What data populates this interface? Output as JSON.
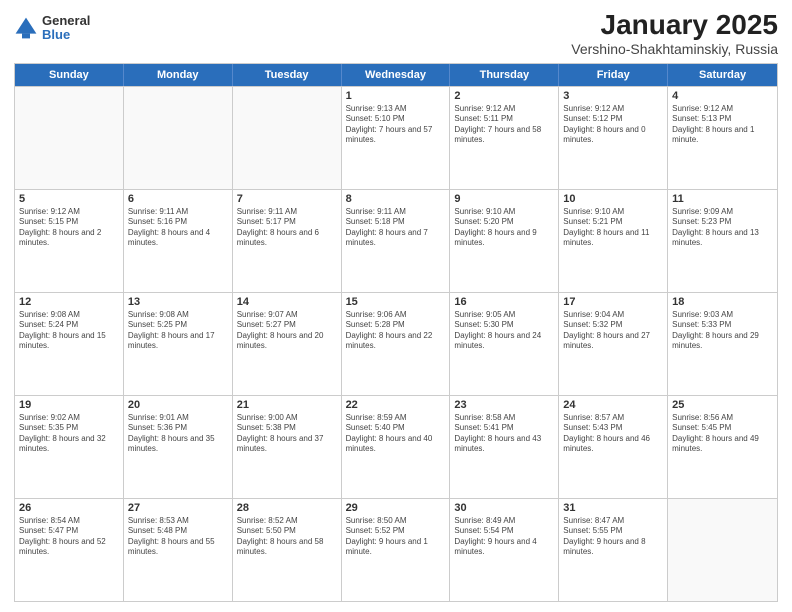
{
  "logo": {
    "general": "General",
    "blue": "Blue"
  },
  "title": "January 2025",
  "subtitle": "Vershino-Shakhtaminskiy, Russia",
  "days": [
    "Sunday",
    "Monday",
    "Tuesday",
    "Wednesday",
    "Thursday",
    "Friday",
    "Saturday"
  ],
  "weeks": [
    [
      {
        "day": "",
        "sunrise": "",
        "sunset": "",
        "daylight": ""
      },
      {
        "day": "",
        "sunrise": "",
        "sunset": "",
        "daylight": ""
      },
      {
        "day": "",
        "sunrise": "",
        "sunset": "",
        "daylight": ""
      },
      {
        "day": "1",
        "sunrise": "Sunrise: 9:13 AM",
        "sunset": "Sunset: 5:10 PM",
        "daylight": "Daylight: 7 hours and 57 minutes."
      },
      {
        "day": "2",
        "sunrise": "Sunrise: 9:12 AM",
        "sunset": "Sunset: 5:11 PM",
        "daylight": "Daylight: 7 hours and 58 minutes."
      },
      {
        "day": "3",
        "sunrise": "Sunrise: 9:12 AM",
        "sunset": "Sunset: 5:12 PM",
        "daylight": "Daylight: 8 hours and 0 minutes."
      },
      {
        "day": "4",
        "sunrise": "Sunrise: 9:12 AM",
        "sunset": "Sunset: 5:13 PM",
        "daylight": "Daylight: 8 hours and 1 minute."
      }
    ],
    [
      {
        "day": "5",
        "sunrise": "Sunrise: 9:12 AM",
        "sunset": "Sunset: 5:15 PM",
        "daylight": "Daylight: 8 hours and 2 minutes."
      },
      {
        "day": "6",
        "sunrise": "Sunrise: 9:11 AM",
        "sunset": "Sunset: 5:16 PM",
        "daylight": "Daylight: 8 hours and 4 minutes."
      },
      {
        "day": "7",
        "sunrise": "Sunrise: 9:11 AM",
        "sunset": "Sunset: 5:17 PM",
        "daylight": "Daylight: 8 hours and 6 minutes."
      },
      {
        "day": "8",
        "sunrise": "Sunrise: 9:11 AM",
        "sunset": "Sunset: 5:18 PM",
        "daylight": "Daylight: 8 hours and 7 minutes."
      },
      {
        "day": "9",
        "sunrise": "Sunrise: 9:10 AM",
        "sunset": "Sunset: 5:20 PM",
        "daylight": "Daylight: 8 hours and 9 minutes."
      },
      {
        "day": "10",
        "sunrise": "Sunrise: 9:10 AM",
        "sunset": "Sunset: 5:21 PM",
        "daylight": "Daylight: 8 hours and 11 minutes."
      },
      {
        "day": "11",
        "sunrise": "Sunrise: 9:09 AM",
        "sunset": "Sunset: 5:23 PM",
        "daylight": "Daylight: 8 hours and 13 minutes."
      }
    ],
    [
      {
        "day": "12",
        "sunrise": "Sunrise: 9:08 AM",
        "sunset": "Sunset: 5:24 PM",
        "daylight": "Daylight: 8 hours and 15 minutes."
      },
      {
        "day": "13",
        "sunrise": "Sunrise: 9:08 AM",
        "sunset": "Sunset: 5:25 PM",
        "daylight": "Daylight: 8 hours and 17 minutes."
      },
      {
        "day": "14",
        "sunrise": "Sunrise: 9:07 AM",
        "sunset": "Sunset: 5:27 PM",
        "daylight": "Daylight: 8 hours and 20 minutes."
      },
      {
        "day": "15",
        "sunrise": "Sunrise: 9:06 AM",
        "sunset": "Sunset: 5:28 PM",
        "daylight": "Daylight: 8 hours and 22 minutes."
      },
      {
        "day": "16",
        "sunrise": "Sunrise: 9:05 AM",
        "sunset": "Sunset: 5:30 PM",
        "daylight": "Daylight: 8 hours and 24 minutes."
      },
      {
        "day": "17",
        "sunrise": "Sunrise: 9:04 AM",
        "sunset": "Sunset: 5:32 PM",
        "daylight": "Daylight: 8 hours and 27 minutes."
      },
      {
        "day": "18",
        "sunrise": "Sunrise: 9:03 AM",
        "sunset": "Sunset: 5:33 PM",
        "daylight": "Daylight: 8 hours and 29 minutes."
      }
    ],
    [
      {
        "day": "19",
        "sunrise": "Sunrise: 9:02 AM",
        "sunset": "Sunset: 5:35 PM",
        "daylight": "Daylight: 8 hours and 32 minutes."
      },
      {
        "day": "20",
        "sunrise": "Sunrise: 9:01 AM",
        "sunset": "Sunset: 5:36 PM",
        "daylight": "Daylight: 8 hours and 35 minutes."
      },
      {
        "day": "21",
        "sunrise": "Sunrise: 9:00 AM",
        "sunset": "Sunset: 5:38 PM",
        "daylight": "Daylight: 8 hours and 37 minutes."
      },
      {
        "day": "22",
        "sunrise": "Sunrise: 8:59 AM",
        "sunset": "Sunset: 5:40 PM",
        "daylight": "Daylight: 8 hours and 40 minutes."
      },
      {
        "day": "23",
        "sunrise": "Sunrise: 8:58 AM",
        "sunset": "Sunset: 5:41 PM",
        "daylight": "Daylight: 8 hours and 43 minutes."
      },
      {
        "day": "24",
        "sunrise": "Sunrise: 8:57 AM",
        "sunset": "Sunset: 5:43 PM",
        "daylight": "Daylight: 8 hours and 46 minutes."
      },
      {
        "day": "25",
        "sunrise": "Sunrise: 8:56 AM",
        "sunset": "Sunset: 5:45 PM",
        "daylight": "Daylight: 8 hours and 49 minutes."
      }
    ],
    [
      {
        "day": "26",
        "sunrise": "Sunrise: 8:54 AM",
        "sunset": "Sunset: 5:47 PM",
        "daylight": "Daylight: 8 hours and 52 minutes."
      },
      {
        "day": "27",
        "sunrise": "Sunrise: 8:53 AM",
        "sunset": "Sunset: 5:48 PM",
        "daylight": "Daylight: 8 hours and 55 minutes."
      },
      {
        "day": "28",
        "sunrise": "Sunrise: 8:52 AM",
        "sunset": "Sunset: 5:50 PM",
        "daylight": "Daylight: 8 hours and 58 minutes."
      },
      {
        "day": "29",
        "sunrise": "Sunrise: 8:50 AM",
        "sunset": "Sunset: 5:52 PM",
        "daylight": "Daylight: 9 hours and 1 minute."
      },
      {
        "day": "30",
        "sunrise": "Sunrise: 8:49 AM",
        "sunset": "Sunset: 5:54 PM",
        "daylight": "Daylight: 9 hours and 4 minutes."
      },
      {
        "day": "31",
        "sunrise": "Sunrise: 8:47 AM",
        "sunset": "Sunset: 5:55 PM",
        "daylight": "Daylight: 9 hours and 8 minutes."
      },
      {
        "day": "",
        "sunrise": "",
        "sunset": "",
        "daylight": ""
      }
    ]
  ]
}
